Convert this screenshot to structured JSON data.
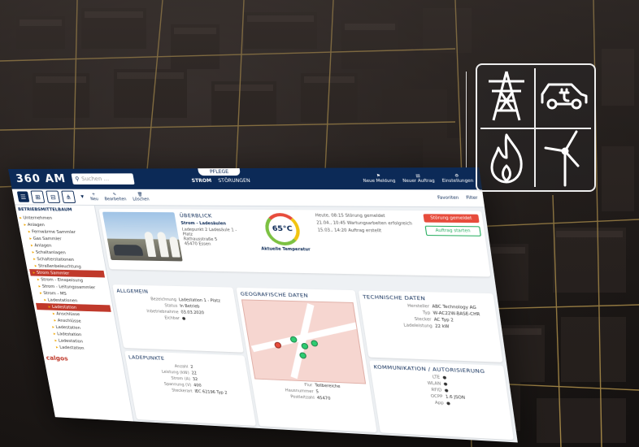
{
  "app": {
    "logo": "360 AM",
    "search_placeholder": "Suchen ...",
    "tab_pill": "PFLEGE",
    "tabs": [
      "STROM",
      "STÖRUNGEN"
    ],
    "top_actions": [
      "Neue Meldung",
      "Neuer Auftrag",
      "Einstellungen"
    ],
    "toolbar_actions": [
      "Neu",
      "Bearbeiten",
      "Löschen"
    ],
    "toolbar_right": [
      "Favoriten",
      "Filter"
    ]
  },
  "tree": {
    "header": "BETRIEBSMITTELBAUM",
    "nodes": [
      {
        "label": "Unternehmen",
        "sel": false
      },
      {
        "label": "Anlagen",
        "sel": false
      },
      {
        "label": "Fernwärme Sammler",
        "sel": false
      },
      {
        "label": "Gas Sammler",
        "sel": false
      },
      {
        "label": "Anlagen",
        "sel": false
      },
      {
        "label": "Schaltanlagen",
        "sel": false
      },
      {
        "label": "Schalterstationen",
        "sel": false
      },
      {
        "label": "Straßenbeleuchtung",
        "sel": false
      },
      {
        "label": "Strom Sammler",
        "sel": true
      },
      {
        "label": "Strom - Einspeisung",
        "sel": false
      },
      {
        "label": "Strom - Leitungssammler",
        "sel": false
      },
      {
        "label": "Strom - MS",
        "sel": false
      },
      {
        "label": "Ladestationen",
        "sel": false
      },
      {
        "label": "Ladestation",
        "sel": true
      },
      {
        "label": "Anschlüsse",
        "sel": false
      },
      {
        "label": "Anschlüsse",
        "sel": false
      },
      {
        "label": "Ladestation",
        "sel": false
      },
      {
        "label": "Ladestation",
        "sel": false
      },
      {
        "label": "Ladestation",
        "sel": false
      },
      {
        "label": "Ladestation",
        "sel": false
      }
    ],
    "brand": "calgos"
  },
  "overview": {
    "title": "ÜBERBLICK",
    "name": "Strom - Ladesäulen",
    "address": [
      "Ladepunkt 2 Ladesäule 1 - Platz",
      "Rathausstraße 5",
      "45470 Essen"
    ],
    "gauge_value": "65°C",
    "gauge_label": "Aktuelle Temperatur",
    "events": [
      "Heute, 08:15 Störung gemeldet",
      "21.04., 10:45 Wartungsarbeiten erfolgreich",
      "15.03., 14:20 Auftrag erstellt"
    ],
    "btn_red": "Störung gemeldet",
    "btn_green": "Auftrag starten"
  },
  "allgemein": {
    "title": "ALLGEMEIN",
    "rows": [
      {
        "k": "Bezeichnung",
        "v": "Ladestation 1 - Platz"
      },
      {
        "k": "Status",
        "v": "In Betrieb"
      },
      {
        "k": "Inbetriebnahme",
        "v": "03.03.2020"
      },
      {
        "k": "Eichbar",
        "v": "●"
      }
    ]
  },
  "geo": {
    "title": "GEOGRAFISCHE DATEN",
    "rows": [
      {
        "k": "Flur",
        "v": "Teilbereiche"
      },
      {
        "k": "Hausnummer",
        "v": "5"
      },
      {
        "k": "Postleitzahl",
        "v": "45470"
      }
    ]
  },
  "technik": {
    "title": "TECHNISCHE DATEN",
    "rows": [
      {
        "k": "Hersteller",
        "v": "ABC Technology AG"
      },
      {
        "k": "Typ",
        "v": "W-AC22W-BASE-CHR"
      },
      {
        "k": "Stecker",
        "v": "AC Typ 2"
      },
      {
        "k": "Ladeleistung",
        "v": "22 kW"
      }
    ]
  },
  "kommunikation": {
    "title": "KOMMUNIKATION / AUTORISIERUNG",
    "rows": [
      {
        "k": "LTE",
        "v": "●"
      },
      {
        "k": "WLAN",
        "v": "●"
      },
      {
        "k": "RFID",
        "v": "●"
      },
      {
        "k": "OCPP",
        "v": "1.6 JSON"
      },
      {
        "k": "App",
        "v": "●"
      }
    ]
  },
  "ladepunkte": {
    "title": "LADEPUNKTE",
    "rows": [
      {
        "k": "Anzahl",
        "v": "2"
      },
      {
        "k": "Leistung (kW)",
        "v": "22"
      },
      {
        "k": "Strom (A)",
        "v": "32"
      },
      {
        "k": "Spannung (V)",
        "v": "400"
      },
      {
        "k": "Steckerart",
        "v": "IEC 62196 Typ 2"
      }
    ]
  },
  "colors": {
    "navy": "#0c2a57",
    "red": "#e74c3c",
    "green": "#27ae60"
  },
  "icons": [
    "power-pylon-icon",
    "electric-car-icon",
    "flame-icon",
    "wind-turbine-icon"
  ]
}
